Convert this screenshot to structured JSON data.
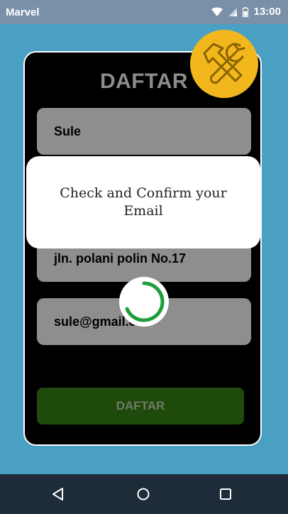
{
  "status_bar": {
    "carrier": "Marvel",
    "time": "13:00"
  },
  "form": {
    "title": "DAFTAR",
    "name_value": "Sule",
    "address_value": "jln. polani polin No.17",
    "email_value": "sule@gmail.co",
    "submit_label": "DAFTAR"
  },
  "dialog": {
    "message": "Check and Confirm your Email"
  },
  "icons": {
    "wifi": "wifi-icon",
    "signal": "signal-icon",
    "battery": "battery-icon",
    "tools": "tools-icon",
    "spinner": "loading-spinner-icon",
    "back": "back-icon",
    "home": "home-icon",
    "recent": "recent-apps-icon"
  },
  "colors": {
    "background": "#4aa0c2",
    "card": "#000000",
    "field": "#8e8e8e",
    "button": "#1e4a0b",
    "badge": "#f2b71d",
    "spinner": "#1e9e3a",
    "nav_bar": "#1e2b38"
  }
}
